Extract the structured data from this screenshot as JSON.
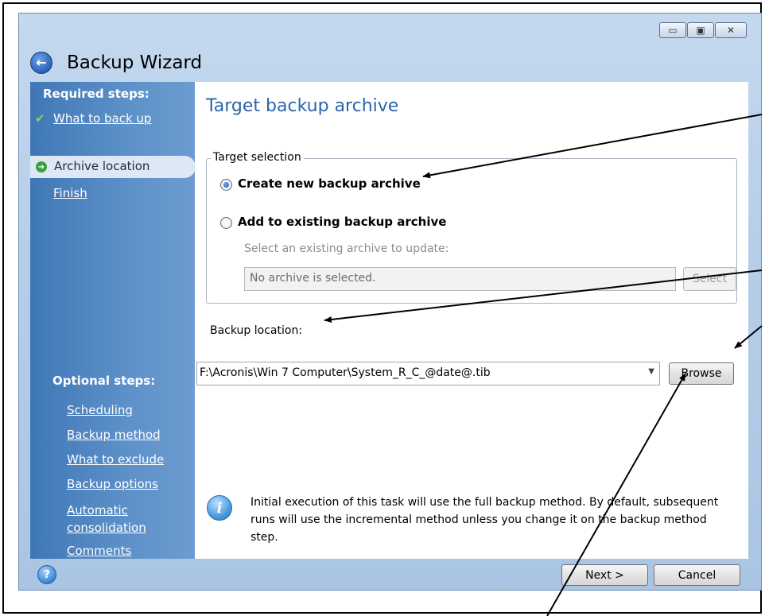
{
  "window": {
    "title": "Backup Wizard",
    "controls": {
      "minimize": "▭",
      "maximize": "▣",
      "close": "✕"
    }
  },
  "sidebar": {
    "required_heading": "Required steps:",
    "required_items": [
      {
        "label": "What to back up",
        "state": "done"
      },
      {
        "label": "Archive location",
        "state": "current"
      },
      {
        "label": "Finish",
        "state": "pending"
      }
    ],
    "optional_heading": "Optional steps:",
    "optional_items": [
      {
        "label": "Scheduling"
      },
      {
        "label": "Backup method"
      },
      {
        "label": "What to exclude"
      },
      {
        "label": "Backup options"
      },
      {
        "label": "Automatic\nconsolidation"
      },
      {
        "label": "Comments"
      }
    ]
  },
  "main": {
    "page_title": "Target backup archive",
    "target_selection": {
      "legend": "Target selection",
      "option_new": "Create new backup archive",
      "option_existing": "Add to existing backup archive",
      "existing_hint": "Select an existing archive to update:",
      "existing_value": "No archive is selected.",
      "select_button": "Select",
      "selected": "new"
    },
    "backup_location": {
      "label": "Backup location:",
      "value": "F:\\Acronis\\Win 7 Computer\\System_R_C_@date@.tib",
      "browse_button": "Browse"
    },
    "info_text": "Initial execution of this task will use the full backup method. By default, subsequent runs will use the incremental method unless you change it on the backup method step."
  },
  "footer": {
    "next_button": "Next >",
    "cancel_button": "Cancel"
  },
  "colors": {
    "accent_title": "#2c65ab",
    "sidebar": "#4f86c3",
    "annotation": "#000000"
  }
}
